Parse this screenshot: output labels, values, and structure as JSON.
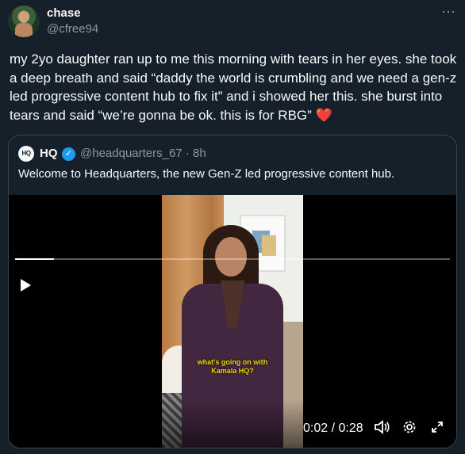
{
  "tweet": {
    "author_name": "chase",
    "author_handle": "@cfree94",
    "more_icon": "more-icon",
    "text": "my 2yo daughter ran up to me this morning with tears in her eyes. she took a deep breath and said “daddy the world is crumbling and we need a gen-z led progressive content hub to fix it” and i showed her this. she burst into tears and said “we’re gonna be ok. this is for RBG”",
    "heart": "❤️"
  },
  "quote": {
    "logo_text": "HQ",
    "name": "HQ",
    "handle_time": "@headquarters_67 · 8h",
    "text": "Welcome to Headquarters, the new Gen-Z led progressive content hub."
  },
  "video": {
    "caption": "what's going on with Kamala HQ?",
    "current_time": "0:02",
    "duration": "0:28",
    "time_display": "0:02 / 0:28",
    "progress_fraction": 0.09
  }
}
